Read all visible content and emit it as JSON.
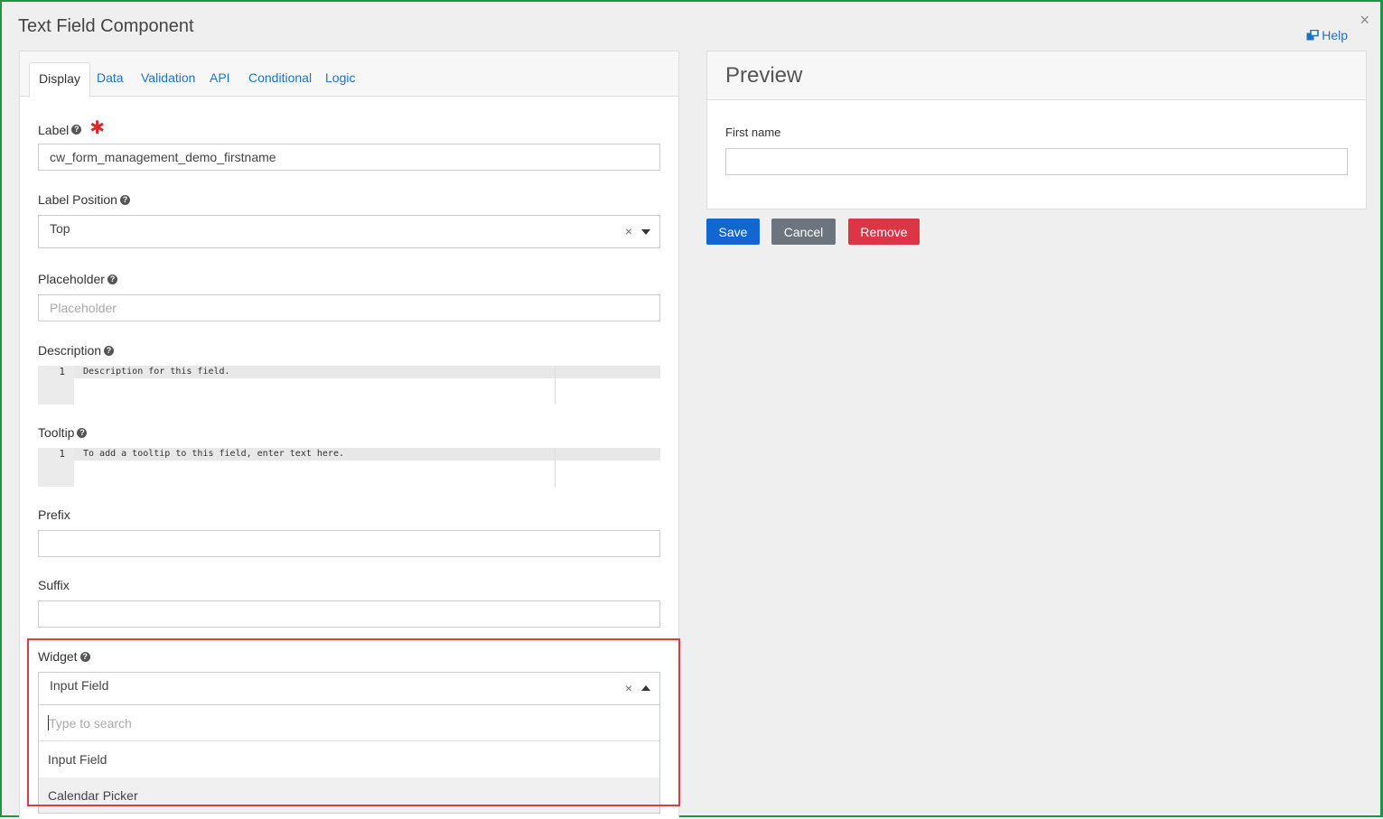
{
  "dialog": {
    "title": "Text Field Component",
    "close_label": "×",
    "help_label": "Help"
  },
  "tabs": [
    {
      "label": "Display",
      "active": true
    },
    {
      "label": "Data"
    },
    {
      "label": "Validation"
    },
    {
      "label": "API"
    },
    {
      "label": "Conditional"
    },
    {
      "label": "Logic"
    }
  ],
  "form": {
    "label": {
      "title": "Label",
      "value": "cw_form_management_demo_firstname",
      "required_mark": "✱"
    },
    "label_position": {
      "title": "Label Position",
      "value": "Top",
      "clear": "×"
    },
    "placeholder": {
      "title": "Placeholder",
      "placeholder": "Placeholder"
    },
    "description": {
      "title": "Description",
      "line": "1",
      "code": "Description for this field."
    },
    "tooltip": {
      "title": "Tooltip",
      "line": "1",
      "code": "To add a tooltip to this field, enter text here."
    },
    "prefix": {
      "title": "Prefix",
      "value": ""
    },
    "suffix": {
      "title": "Suffix",
      "value": ""
    },
    "widget": {
      "title": "Widget",
      "value": "Input Field",
      "clear": "×",
      "search_placeholder": "Type to search",
      "options": [
        "Input Field",
        "Calendar Picker"
      ]
    }
  },
  "preview": {
    "title": "Preview",
    "field_label": "First name",
    "field_value": ""
  },
  "actions": {
    "save": "Save",
    "cancel": "Cancel",
    "remove": "Remove"
  },
  "colors": {
    "accent_link": "#1a73c7",
    "save": "#1266d0",
    "cancel": "#6c757d",
    "remove": "#dc3545",
    "highlight": "#e03b43",
    "frame": "#1e9448"
  }
}
